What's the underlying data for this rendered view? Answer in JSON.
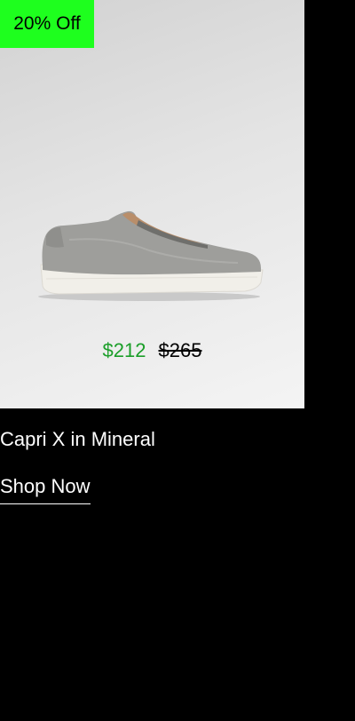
{
  "product": {
    "badge": "20% Off",
    "price_sale": "$212",
    "price_original": "$265",
    "name": "Capri X in Mineral",
    "cta_label": "Shop Now",
    "image_icon": "sneaker-product-image"
  },
  "colors": {
    "badge_background": "#1eff1e",
    "sale_price": "#1a9e28",
    "original_price": "#000000",
    "page_background": "#000000",
    "text": "#ffffff"
  }
}
